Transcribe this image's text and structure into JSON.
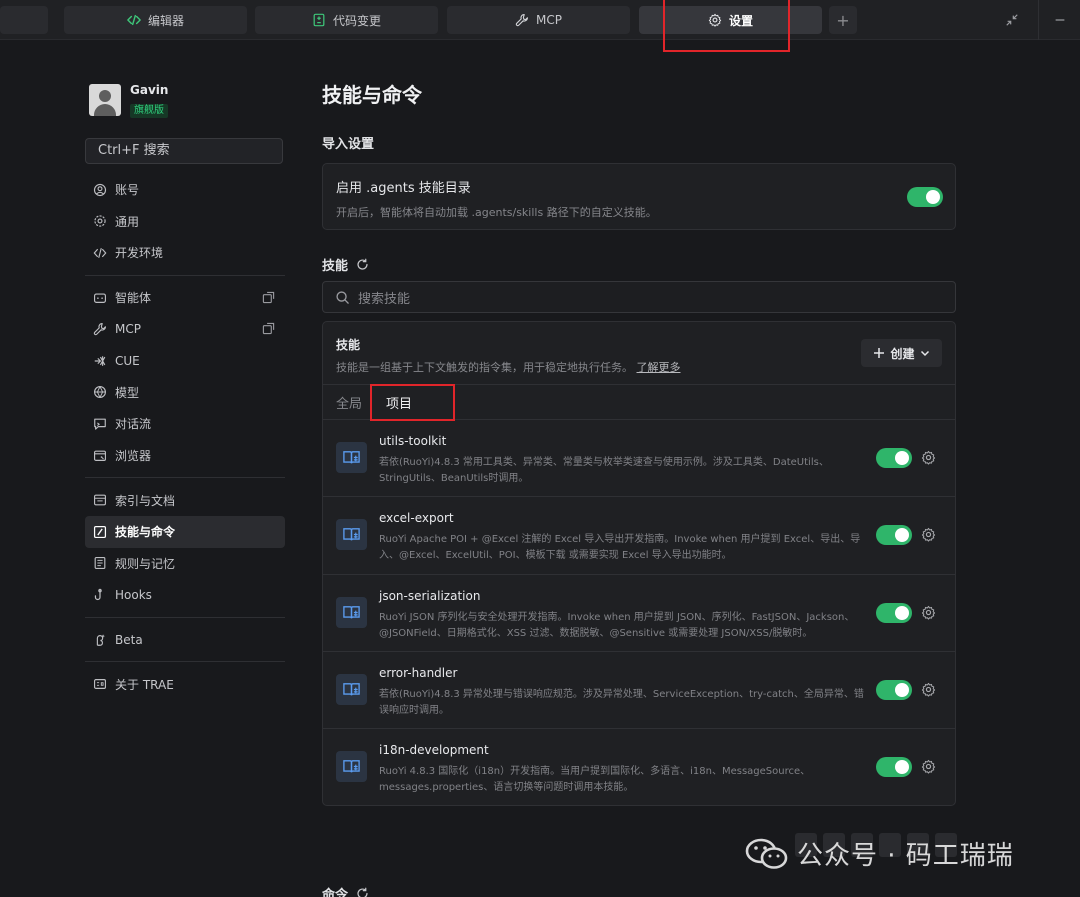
{
  "tabs": [
    {
      "label": "编辑器",
      "icon": "code-icon"
    },
    {
      "label": "代码变更",
      "icon": "diff-icon"
    },
    {
      "label": "MCP",
      "icon": "wrench-icon"
    },
    {
      "label": "设置",
      "icon": "gear-icon"
    }
  ],
  "tab_add_label": "+",
  "user": {
    "name": "Gavin",
    "badge": "旗舰版"
  },
  "sidebar": {
    "search_placeholder": "Ctrl+F 搜索",
    "groups": [
      [
        {
          "label": "账号",
          "icon": "account-icon"
        },
        {
          "label": "通用",
          "icon": "settings-icon"
        },
        {
          "label": "开发环境",
          "icon": "code-icon"
        }
      ],
      [
        {
          "label": "智能体",
          "icon": "agent-icon"
        },
        {
          "label": "MCP",
          "icon": "wrench-icon"
        },
        {
          "label": "CUE",
          "icon": "cue-icon"
        },
        {
          "label": "模型",
          "icon": "model-icon"
        },
        {
          "label": "对话流",
          "icon": "chat-icon"
        },
        {
          "label": "浏览器",
          "icon": "browser-icon"
        }
      ],
      [
        {
          "label": "索引与文档",
          "icon": "index-icon"
        },
        {
          "label": "技能与命令",
          "icon": "skill-icon",
          "active": true
        },
        {
          "label": "规则与记忆",
          "icon": "rules-icon"
        },
        {
          "label": "Hooks",
          "icon": "hook-icon"
        }
      ],
      [
        {
          "label": "Beta",
          "icon": "beta-icon"
        }
      ],
      [
        {
          "label": "关于 TRAE",
          "icon": "about-icon"
        }
      ]
    ]
  },
  "main": {
    "title": "技能与命令",
    "import_section": {
      "title": "导入设置",
      "option_title": "启用 .agents 技能目录",
      "option_desc": "开启后，智能体将自动加载 .agents/skills 路径下的自定义技能。",
      "enabled": true
    },
    "skills_section": {
      "title": "技能",
      "search_placeholder": "搜索技能",
      "panel_title": "技能",
      "panel_desc": "技能是一组基于上下文触发的指令集，用于稳定地执行任务。",
      "learn_more": "了解更多",
      "create_label": "创建",
      "tabs": [
        "全局",
        "项目"
      ],
      "active_tab": "项目",
      "items": [
        {
          "name": "utils-toolkit",
          "desc": "若依(RuoYi)4.8.3 常用工具类、异常类、常量类与枚举类速查与使用示例。涉及工具类、DateUtils、StringUtils、BeanUtils时调用。",
          "enabled": true
        },
        {
          "name": "excel-export",
          "desc": "RuoYi Apache POI + @Excel 注解的 Excel 导入导出开发指南。Invoke when 用户提到 Excel、导出、导入、@Excel、ExcelUtil、POI、模板下载 或需要实现 Excel 导入导出功能时。",
          "enabled": true
        },
        {
          "name": "json-serialization",
          "desc": "RuoYi JSON 序列化与安全处理开发指南。Invoke when 用户提到 JSON、序列化、FastJSON、Jackson、@JSONField、日期格式化、XSS 过滤、数据脱敏、@Sensitive 或需要处理 JSON/XSS/脱敏时。",
          "enabled": true
        },
        {
          "name": "error-handler",
          "desc": "若依(RuoYi)4.8.3 异常处理与错误响应规范。涉及异常处理、ServiceException、try-catch、全局异常、错误响应时调用。",
          "enabled": true
        },
        {
          "name": "i18n-development",
          "desc": "RuoYi 4.8.3 国际化（i18n）开发指南。当用户提到国际化、多语言、i18n、MessageSource、messages.properties、语言切换等问题时调用本技能。",
          "enabled": true
        }
      ]
    },
    "commands_section": {
      "title": "命令"
    }
  },
  "watermark": {
    "text": "公众号 · 码工瑞瑞"
  },
  "colors": {
    "accent_green": "#2fb56a",
    "highlight_red": "#e1252a",
    "background": "#18191c"
  }
}
